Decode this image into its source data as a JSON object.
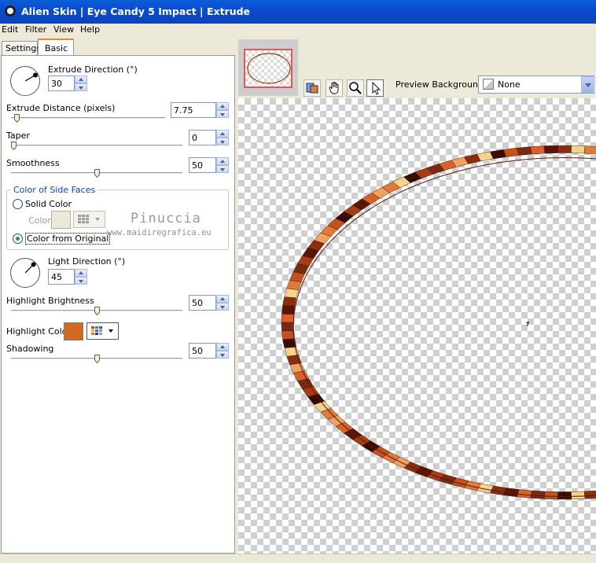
{
  "window": {
    "title": "Alien Skin | Eye Candy 5 Impact | Extrude"
  },
  "menu": [
    "Edit",
    "Filter",
    "View",
    "Help"
  ],
  "tabs": [
    {
      "label": "Settings"
    },
    {
      "label": "Basic",
      "selected": true
    }
  ],
  "controls": {
    "extrude_direction": {
      "label": "Extrude Direction (°)",
      "value": "30"
    },
    "extrude_distance": {
      "label": "Extrude Distance (pixels)",
      "value": "7.75",
      "slider_fraction": 0.02
    },
    "taper": {
      "label": "Taper",
      "value": "0",
      "slider_fraction": 0.0
    },
    "smoothness": {
      "label": "Smoothness",
      "value": "50",
      "slider_fraction": 0.5
    },
    "side_faces": {
      "group_label": "Color of Side Faces",
      "solid_color_label": "Solid Color",
      "color_label": "Color",
      "from_original_label": "Color from Original",
      "selected": "from_original",
      "solid_swatch_color": "#ece9d8"
    },
    "light_direction": {
      "label": "Light Direction (°)",
      "value": "45"
    },
    "highlight_brightness": {
      "label": "Highlight Brightness",
      "value": "50",
      "slider_fraction": 0.5
    },
    "highlight_color": {
      "label": "Highlight Color",
      "color": "#d2691e"
    },
    "shadowing": {
      "label": "Shadowing",
      "value": "50",
      "slider_fraction": 0.5
    }
  },
  "watermark": {
    "name": "Pinuccia",
    "url": "www.maidiregrafica.eu"
  },
  "preview": {
    "background_label": "Preview Background:",
    "background_value": "None"
  },
  "colors": {
    "titlebar": "#0a4ccf",
    "accent_tab": "#e68b2c",
    "group_title": "#0046d5",
    "ring_colors": [
      "#8b2e10",
      "#c4511b",
      "#5a1408",
      "#e07a3a",
      "#a63d16",
      "#f0a35e",
      "#3b0c04",
      "#d9622a",
      "#f6d38a",
      "#7a2a12"
    ]
  },
  "icons": {
    "app": "eye-icon",
    "tools": [
      "preview-compare-icon",
      "hand-icon",
      "zoom-icon",
      "pointer-icon"
    ]
  }
}
